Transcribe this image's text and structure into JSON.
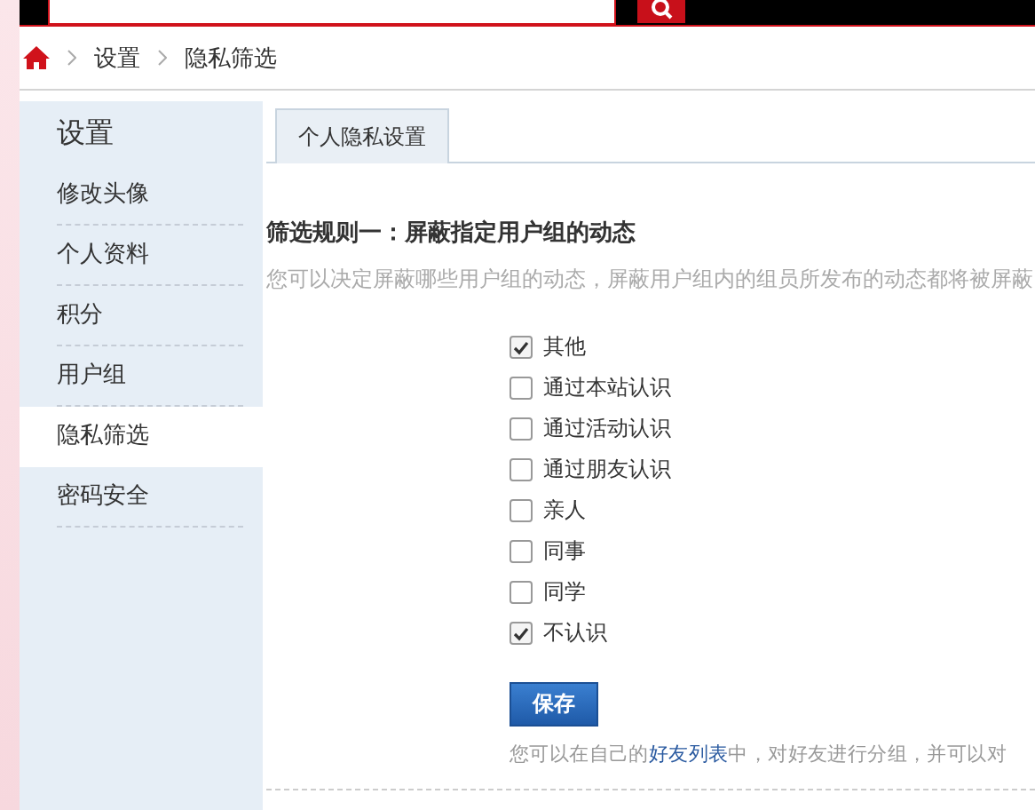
{
  "breadcrumb": [
    "设置",
    "隐私筛选"
  ],
  "sidebar": {
    "title": "设置",
    "items": [
      {
        "label": "修改头像",
        "selected": false
      },
      {
        "label": "个人资料",
        "selected": false
      },
      {
        "label": "积分",
        "selected": false
      },
      {
        "label": "用户组",
        "selected": false
      },
      {
        "label": "隐私筛选",
        "selected": true
      },
      {
        "label": "密码安全",
        "selected": false
      }
    ]
  },
  "tabs": [
    {
      "label": "个人隐私设置",
      "selected": true
    }
  ],
  "rule": {
    "title": "筛选规则一：屏蔽指定用户组的动态",
    "description": "您可以决定屏蔽哪些用户组的动态，屏蔽用户组内的组员所发布的动态都将被屏蔽",
    "groups": [
      {
        "label": "其他",
        "checked": true
      },
      {
        "label": "通过本站认识",
        "checked": false
      },
      {
        "label": "通过活动认识",
        "checked": false
      },
      {
        "label": "通过朋友认识",
        "checked": false
      },
      {
        "label": "亲人",
        "checked": false
      },
      {
        "label": "同事",
        "checked": false
      },
      {
        "label": "同学",
        "checked": false
      },
      {
        "label": "不认识",
        "checked": true
      }
    ]
  },
  "save_button": "保存",
  "note": {
    "before": "您可以在自己的",
    "link": "好友列表",
    "after": "中，对好友进行分组，并可以对"
  }
}
